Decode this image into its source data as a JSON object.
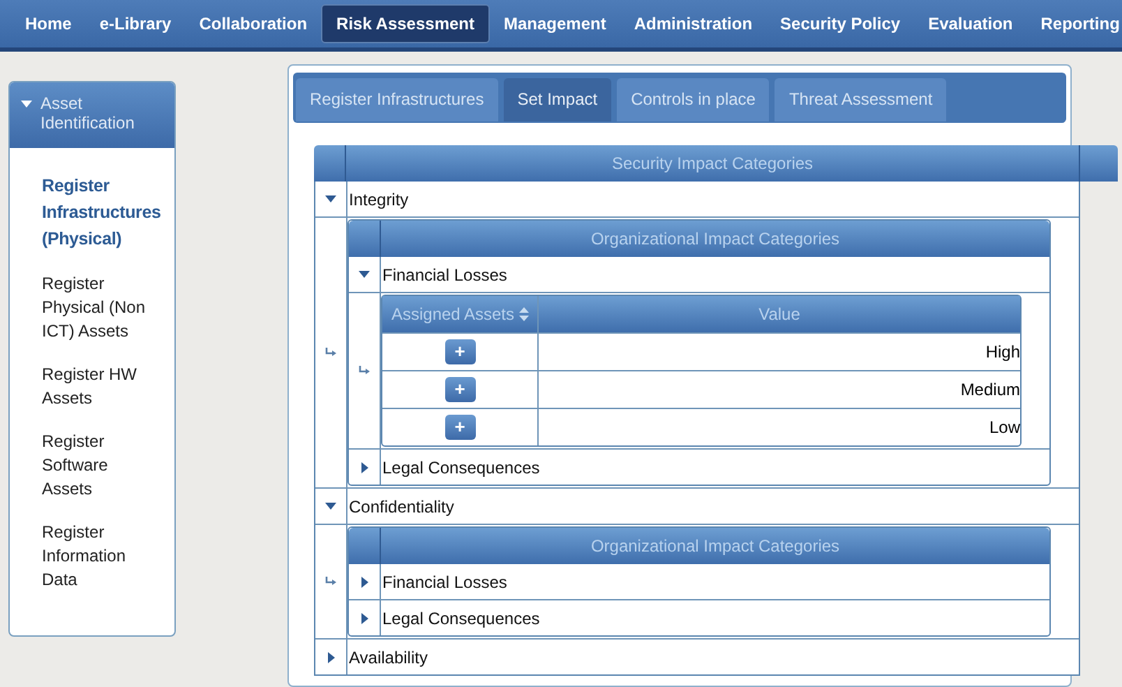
{
  "nav": [
    {
      "label": "Home",
      "selected": false
    },
    {
      "label": "e-Library",
      "selected": false
    },
    {
      "label": "Collaboration",
      "selected": false
    },
    {
      "label": "Risk Assessment",
      "selected": true
    },
    {
      "label": "Management",
      "selected": false
    },
    {
      "label": "Administration",
      "selected": false
    },
    {
      "label": "Security Policy",
      "selected": false
    },
    {
      "label": "Evaluation",
      "selected": false
    },
    {
      "label": "Reporting",
      "selected": false
    }
  ],
  "sidebar": {
    "header": {
      "label": "Asset Identification",
      "expanded": true
    },
    "items": [
      {
        "label": "Register Infrastructures (Physical)",
        "selected": true
      },
      {
        "label": "Register Physical (Non ICT) Assets",
        "selected": false
      },
      {
        "label": "Register HW Assets",
        "selected": false
      },
      {
        "label": "Register Software Assets",
        "selected": false
      },
      {
        "label": "Register Information Data",
        "selected": false
      }
    ]
  },
  "tabs": [
    {
      "label": "Register Infrastructures",
      "selected": false
    },
    {
      "label": "Set Impact",
      "selected": true
    },
    {
      "label": "Controls in place",
      "selected": false
    },
    {
      "label": "Threat Assessment",
      "selected": false
    }
  ],
  "grid": {
    "kind": "categories",
    "title": "Security Impact Categories",
    "rows": [
      {
        "label": "Integrity",
        "expanded": true,
        "detail": {
          "kind": "categories",
          "title": "Organizational Impact Categories",
          "rows": [
            {
              "label": "Financial Losses",
              "expanded": true,
              "detail": {
                "kind": "assets",
                "columns": [
                  {
                    "label": "Assigned Assets",
                    "sortable": true
                  },
                  {
                    "label": "Value"
                  }
                ],
                "rows": [
                  {
                    "action": "+",
                    "value": "High"
                  },
                  {
                    "action": "+",
                    "value": "Medium"
                  },
                  {
                    "action": "+",
                    "value": "Low"
                  }
                ]
              }
            },
            {
              "label": "Legal Consequences",
              "expanded": false
            }
          ]
        }
      },
      {
        "label": "Confidentiality",
        "expanded": true,
        "detail": {
          "kind": "categories",
          "title": "Organizational Impact Categories",
          "rows": [
            {
              "label": "Financial Losses",
              "expanded": false
            },
            {
              "label": "Legal Consequences",
              "expanded": false
            }
          ]
        }
      },
      {
        "label": "Availability",
        "expanded": false
      }
    ]
  }
}
